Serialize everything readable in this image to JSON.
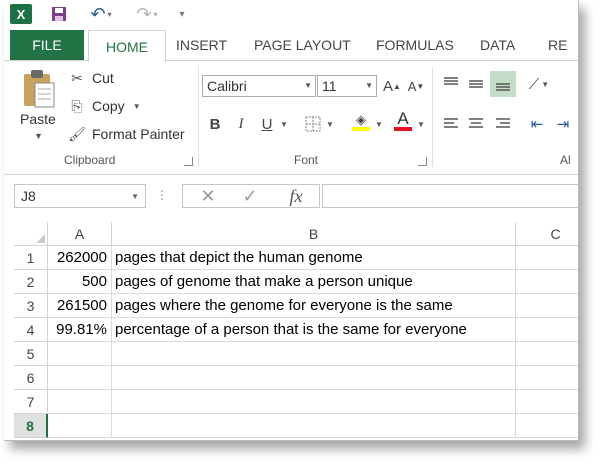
{
  "qat": {
    "app_icon": "excel-icon",
    "app_letter": "X",
    "save_icon": "save-icon",
    "undo_icon": "undo-icon",
    "redo_icon": "redo-icon"
  },
  "tabs": [
    "FILE",
    "HOME",
    "INSERT",
    "PAGE LAYOUT",
    "FORMULAS",
    "DATA",
    "RE"
  ],
  "ribbon": {
    "clipboard": {
      "paste": "Paste",
      "cut": "Cut",
      "copy": "Copy",
      "format_painter": "Format Painter",
      "group_label": "Clipboard"
    },
    "font": {
      "font_name": "Calibri",
      "font_size": "11",
      "grow": "A",
      "shrink": "A",
      "bold": "B",
      "italic": "I",
      "underline": "U",
      "font_color_letter": "A",
      "group_label": "Font",
      "fill_color": "#ffff00",
      "font_color": "#e81123"
    },
    "alignment": {
      "group_label": "Al"
    }
  },
  "formula_bar": {
    "name_box": "J8",
    "cancel": "✕",
    "enter": "✓",
    "function": "fx",
    "value": ""
  },
  "sheet": {
    "columns": [
      "A",
      "B",
      "C"
    ],
    "rows": [
      "1",
      "2",
      "3",
      "4",
      "5",
      "6",
      "7",
      "8"
    ],
    "active_row": "8",
    "cells": [
      [
        "262000",
        "pages that depict the human genome"
      ],
      [
        "500",
        "pages of genome that make a person unique"
      ],
      [
        "261500",
        "pages where the genome for everyone is the same"
      ],
      [
        "99.81%",
        "percentage of a person that is the same for everyone"
      ]
    ]
  },
  "colors": {
    "excel_green": "#217346",
    "header_active_bg": "#e1e1e1"
  }
}
